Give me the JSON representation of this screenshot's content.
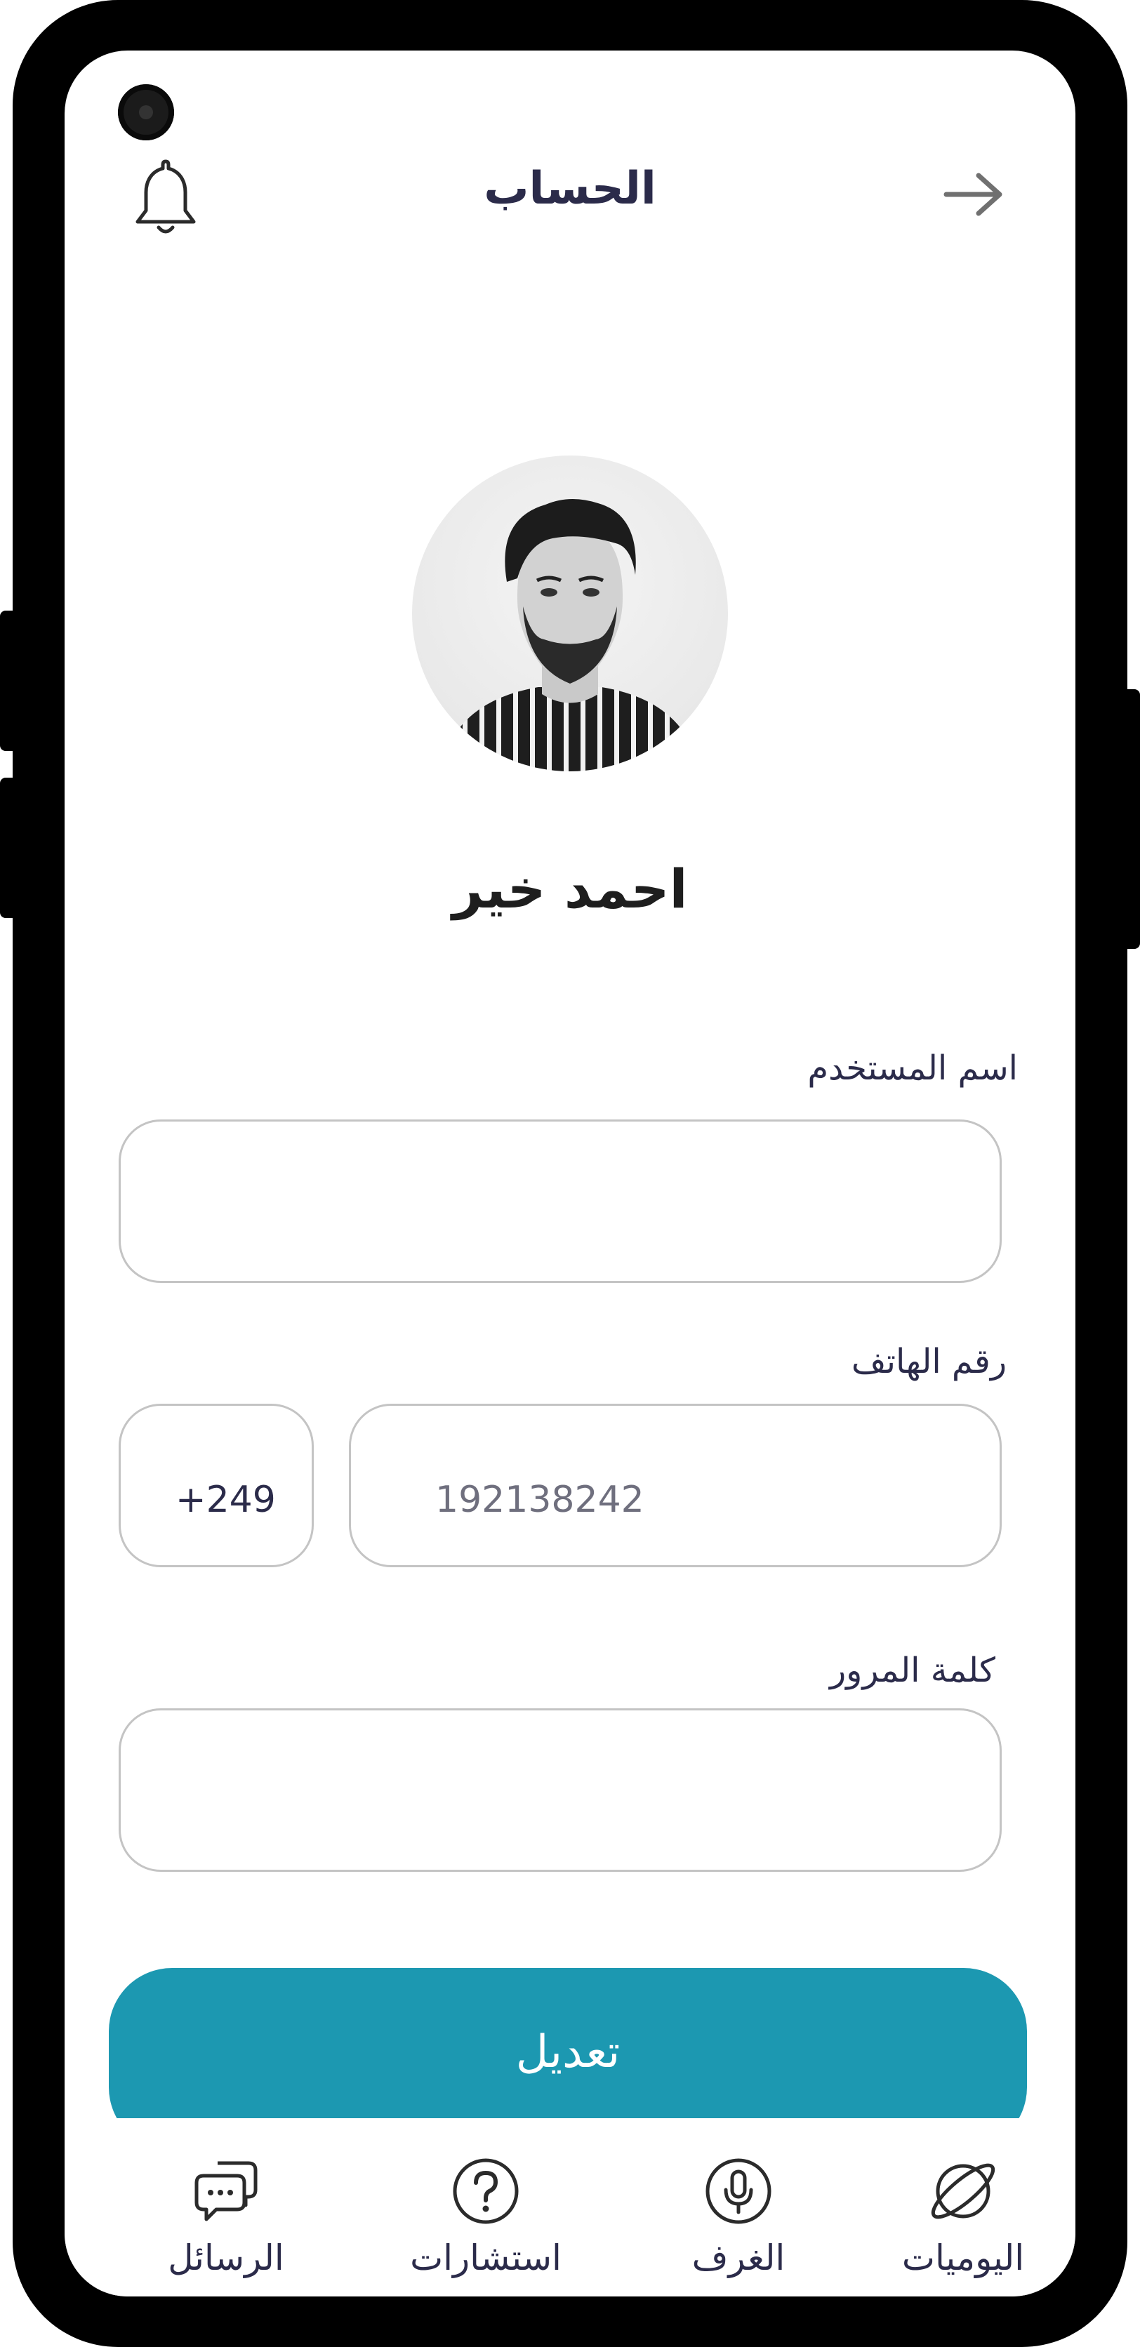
{
  "header": {
    "title": "الحساب"
  },
  "profile": {
    "name": "احمد خير"
  },
  "form": {
    "username_label": "اسم المستخدم",
    "username_value": "",
    "phone_label": "رقم الهاتف",
    "country_code": "+249",
    "phone_value": "192138242",
    "password_label": "كلمة المرور",
    "password_value": ""
  },
  "actions": {
    "edit_label": "تعديل"
  },
  "tabs": [
    {
      "label": "الرسائل",
      "icon": "chat-icon"
    },
    {
      "label": "استشارات",
      "icon": "question-icon"
    },
    {
      "label": "الغرف",
      "icon": "microphone-icon"
    },
    {
      "label": "اليوميات",
      "icon": "planet-icon"
    }
  ],
  "colors": {
    "accent": "#1c98b1",
    "text": "#2b2b4a",
    "border": "#c4c4c4"
  }
}
